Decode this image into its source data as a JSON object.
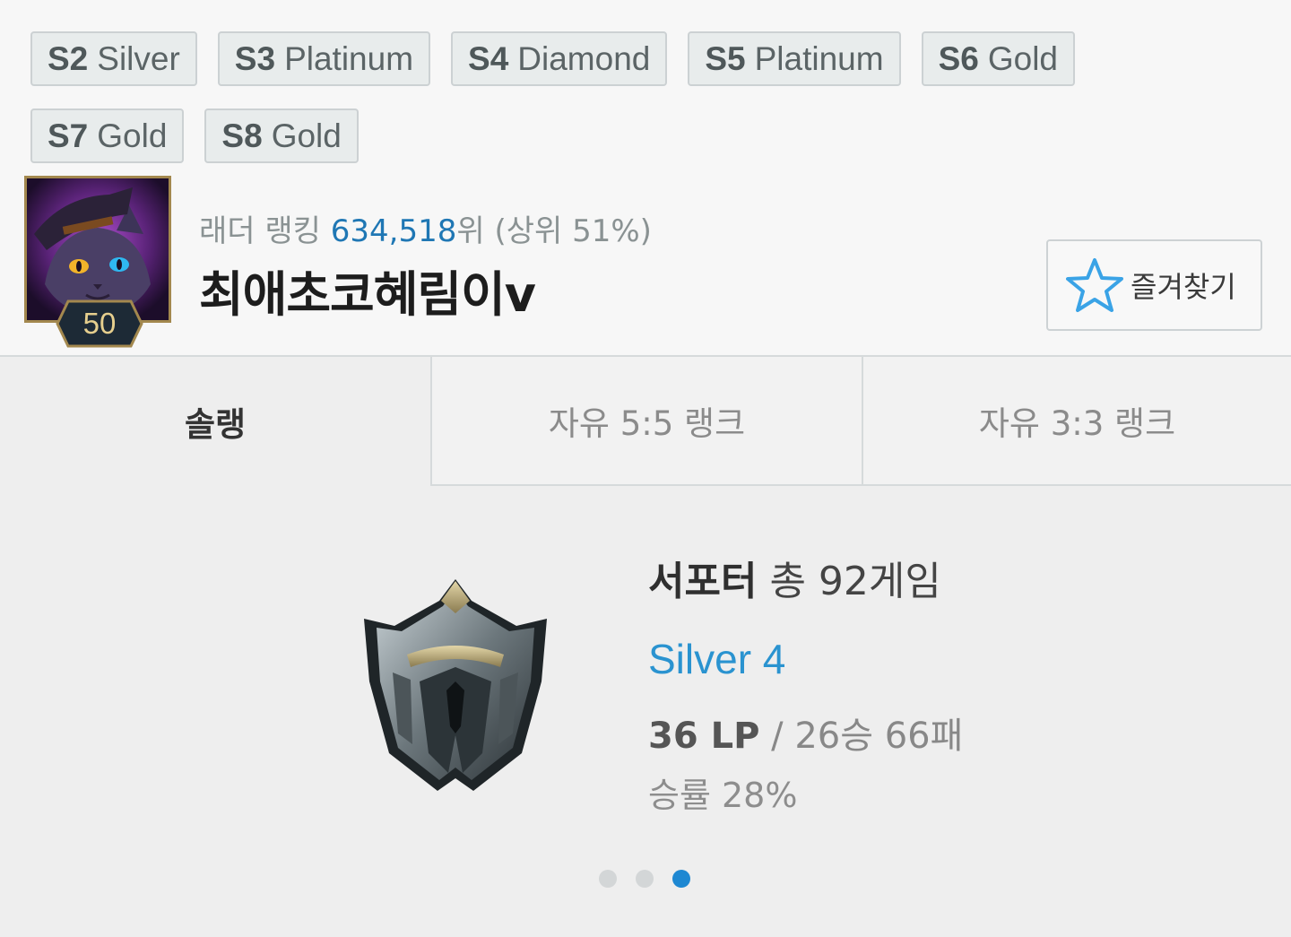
{
  "seasons": [
    {
      "season": "S2",
      "tier": "Silver"
    },
    {
      "season": "S3",
      "tier": "Platinum"
    },
    {
      "season": "S4",
      "tier": "Diamond"
    },
    {
      "season": "S5",
      "tier": "Platinum"
    },
    {
      "season": "S6",
      "tier": "Gold"
    },
    {
      "season": "S7",
      "tier": "Gold"
    },
    {
      "season": "S8",
      "tier": "Gold"
    }
  ],
  "profile": {
    "level": "50",
    "ladder_label": "래더 랭킹",
    "ladder_rank": "634,518",
    "ladder_suffix": "위 (상위 51%)",
    "summoner_name": "최애초코혜림이v",
    "favorite_label": "즐겨찾기",
    "favorite_icon": "star-outline-icon"
  },
  "tabs": [
    "솔랭",
    "자유 5:5 랭크",
    "자유 3:3 랭크"
  ],
  "active_tab": 0,
  "rank_card": {
    "position": "서포터",
    "games": "총 92게임",
    "tier": "Silver 4",
    "lp": "36 LP",
    "record": " / 26승 66패",
    "winrate": "승률 28%",
    "emblem_icon": "silver-emblem-icon"
  },
  "pagination": {
    "count": 3,
    "active": 2
  },
  "colors": {
    "accent": "#1e88d2",
    "tier_text": "#2a93d0",
    "rank_link": "#1f77b4"
  }
}
